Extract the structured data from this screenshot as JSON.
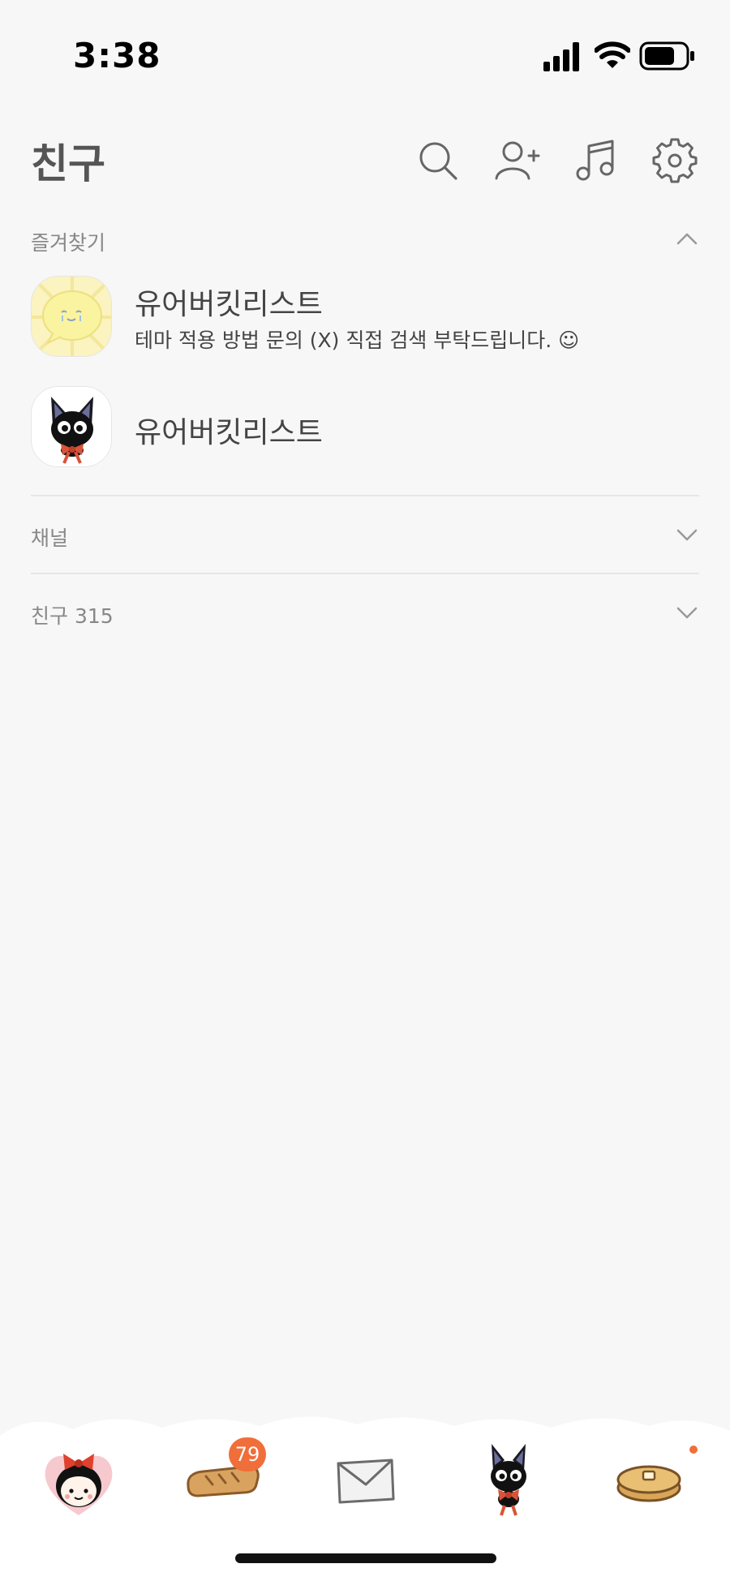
{
  "status_bar": {
    "time": "3:38"
  },
  "header": {
    "title": "친구"
  },
  "favorites": {
    "label": "즐겨찾기",
    "friends": [
      {
        "name": "유어버킷리스트",
        "status": "테마 적용 방법 문의 (X) 직접 검색 부탁드립니다. ☺︎"
      },
      {
        "name": "유어버킷리스트",
        "status": ""
      }
    ]
  },
  "channel": {
    "label": "채널"
  },
  "friends_section": {
    "label": "친구 315"
  },
  "tabbar": {
    "chats_badge": "79"
  },
  "colors": {
    "background": "#f7f7f7",
    "badge": "#f06e3a",
    "text": "#444444"
  }
}
